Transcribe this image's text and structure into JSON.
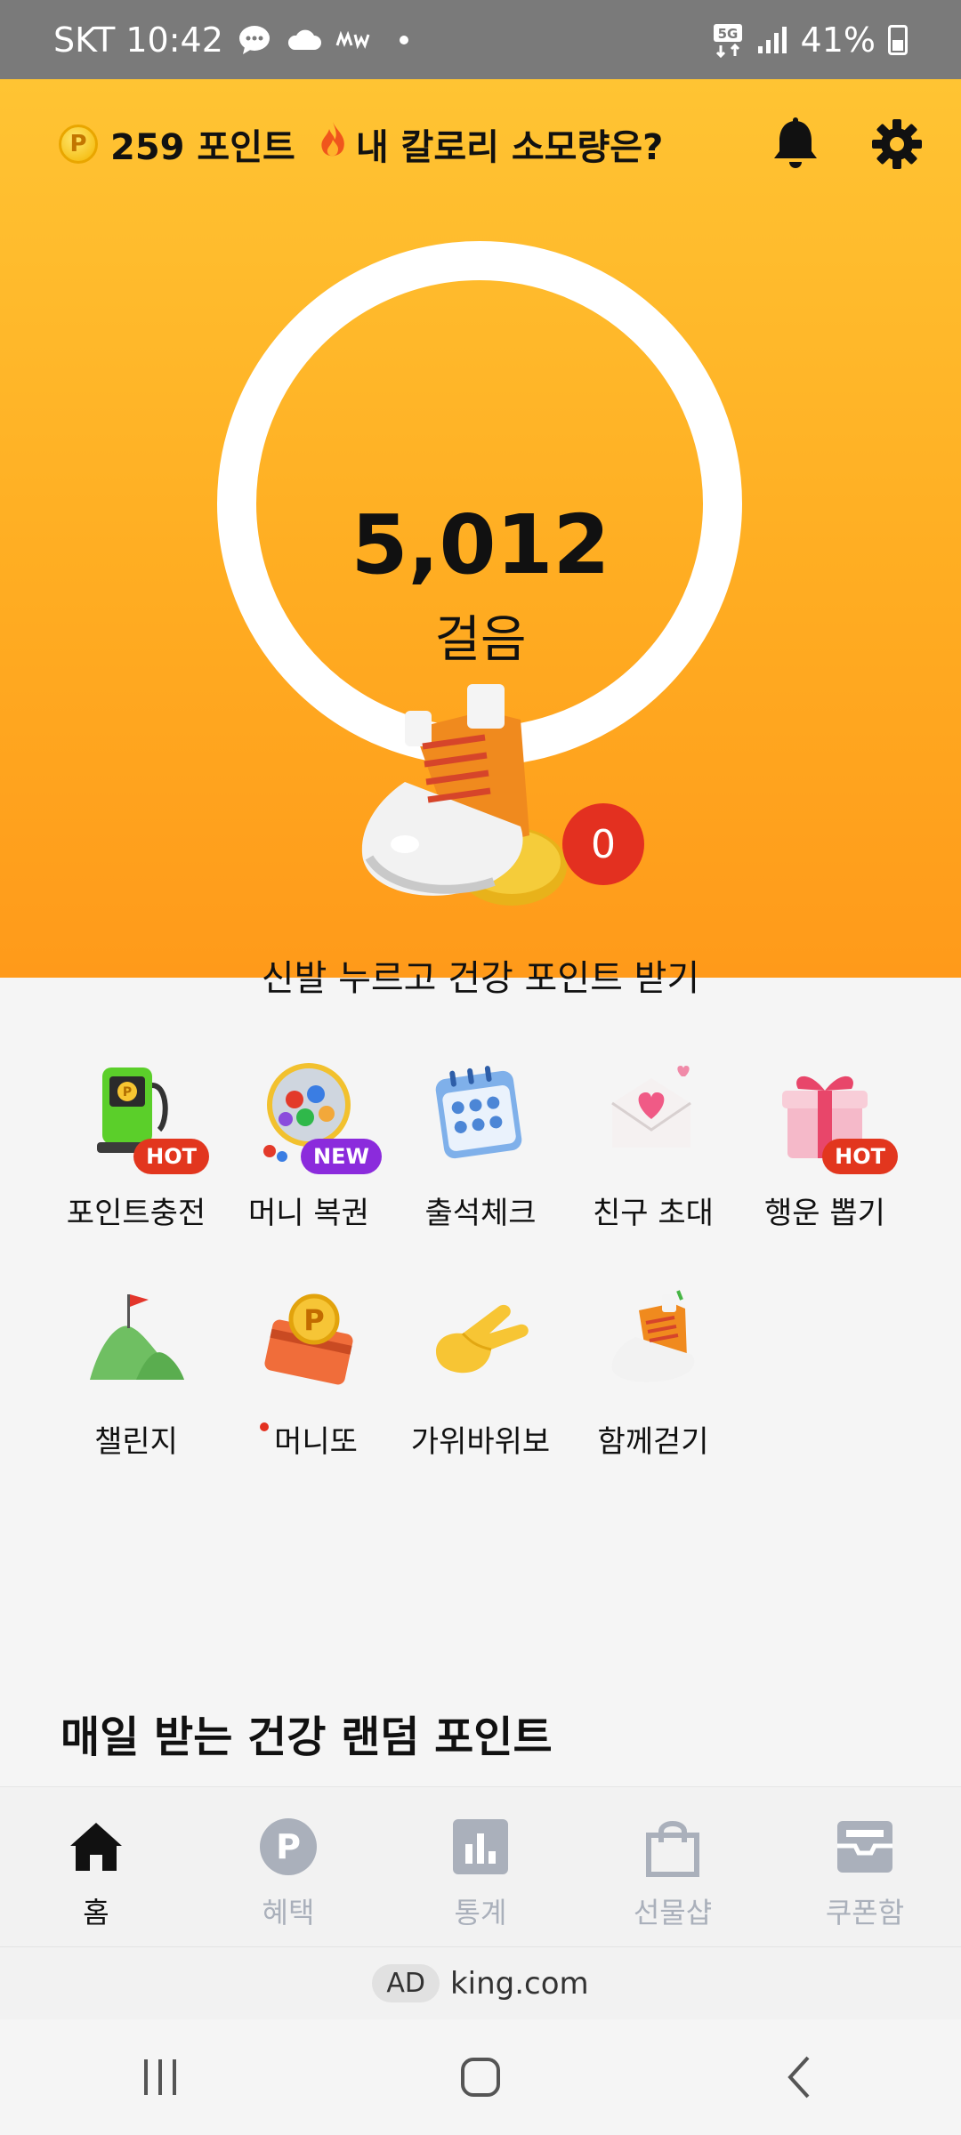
{
  "status_bar": {
    "carrier_time": "SKT 10:42",
    "network": "5G",
    "battery": "41%"
  },
  "header": {
    "points": "259 포인트",
    "calorie_prompt": "내 칼로리 소모량은?",
    "coin_letter": "P"
  },
  "hero": {
    "steps": "5,012",
    "steps_label": "걸음",
    "badge_count": "0",
    "hint": "신발 누르고 건강 포인트 받기"
  },
  "menu": {
    "items": [
      {
        "label": "포인트충전",
        "tag": "HOT"
      },
      {
        "label": "머니 복권",
        "tag": "NEW"
      },
      {
        "label": "출석체크"
      },
      {
        "label": "친구 초대"
      },
      {
        "label": "행운 뽑기",
        "tag": "HOT"
      },
      {
        "label": "챌린지"
      },
      {
        "label": "머니또"
      },
      {
        "label": "가위바위보"
      },
      {
        "label": "함께걷기"
      }
    ]
  },
  "section": {
    "title": "매일 받는 건강 랜덤 포인트"
  },
  "bottom_nav": {
    "items": [
      {
        "label": "홈",
        "icon": "home-icon",
        "active": true
      },
      {
        "label": "혜택",
        "icon": "points-icon"
      },
      {
        "label": "통계",
        "icon": "stats-icon"
      },
      {
        "label": "선물샵",
        "icon": "shopping-bag-icon"
      },
      {
        "label": "쿠폰함",
        "icon": "coupon-box-icon"
      }
    ]
  },
  "ad": {
    "label": "AD",
    "text": "king.com"
  },
  "colors": {
    "hero_top": "#ffc433",
    "hero_bottom": "#ff9a1a",
    "hot_tag": "#e2361e",
    "new_tag": "#8b2bdc",
    "badge": "#e33020"
  }
}
